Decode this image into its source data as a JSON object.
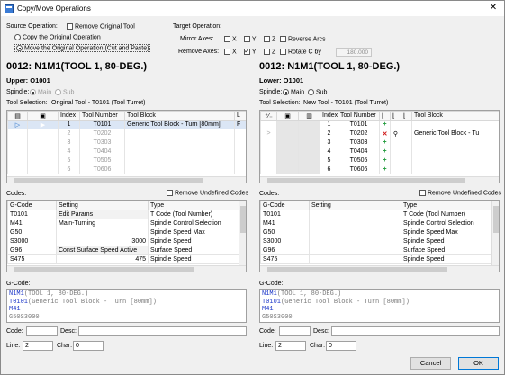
{
  "window": {
    "title": "Copy/Move Operations",
    "close_glyph": "✕"
  },
  "source_op": {
    "label": "Source Operation:",
    "remove_original": "Remove Original Tool",
    "copy_label": "Copy the Original Operation",
    "move_label": "Move the Original Operation (Cut and Paste)"
  },
  "target_op": {
    "label": "Target Operation:",
    "mirror_label": "Mirror Axes:",
    "remove_label": "Remove Axes:",
    "x": "X",
    "y": "Y",
    "z": "Z",
    "reverse_arcs": "Reverse Arcs",
    "rotate_c": "Rotate C by",
    "rotate_value": "180.000"
  },
  "left": {
    "title": "0012: N1M1(TOOL 1, 80-DEG.)",
    "subtitle": "Upper: O1001",
    "spindle_label": "Spindle:",
    "spindle_main": "Main",
    "spindle_sub": "Sub",
    "toolsel_label": "Tool Selection:",
    "toolsel_value": "Original Tool - T0101 (Tool Turret)",
    "cols": {
      "index": "Index",
      "tool_number": "Tool Number",
      "tool_block": "Tool Block",
      "extra": "L"
    },
    "rows": [
      {
        "index": "1",
        "tool": "T0101",
        "block": "Generic Tool Block - Turn [80mm]",
        "extra": "F"
      },
      {
        "index": "2",
        "tool": "T0202",
        "block": "",
        "extra": ""
      },
      {
        "index": "3",
        "tool": "T0303",
        "block": "",
        "extra": ""
      },
      {
        "index": "4",
        "tool": "T0404",
        "block": "",
        "extra": ""
      },
      {
        "index": "5",
        "tool": "T0505",
        "block": "",
        "extra": ""
      },
      {
        "index": "6",
        "tool": "T0606",
        "block": "",
        "extra": ""
      }
    ],
    "codes_label": "Codes:",
    "remove_undefined": "Remove Undefined Codes",
    "code_cols": {
      "gcode": "G-Code",
      "setting": "Setting",
      "type": "Type"
    },
    "codes": [
      {
        "gcode": "T0101",
        "setting": "Edit Params",
        "value": "",
        "type": "T Code (Tool Number)"
      },
      {
        "gcode": "M41",
        "setting": "Main-Turning",
        "value": "",
        "type": "Spindle Control Selection"
      },
      {
        "gcode": "G50",
        "setting": "",
        "value": "",
        "type": "Spindle Speed Max"
      },
      {
        "gcode": "S3000",
        "setting": "",
        "value": "3000",
        "type": "Spindle Speed"
      },
      {
        "gcode": "G96",
        "setting": "Const Surface Speed Active",
        "value": "",
        "type": "Surface Speed"
      },
      {
        "gcode": "S475",
        "setting": "",
        "value": "475",
        "type": "Spindle Speed"
      }
    ],
    "gcode_label": "G-Code:",
    "gcode_lines": [
      "N1M1(TOOL 1, 80-DEG.)",
      "T0101(Generic Tool Block - Turn [80mm])",
      "M41",
      "G50S3000"
    ],
    "code_label": "Code:",
    "desc_label": "Desc:",
    "line_label": "Line:",
    "line_value": "2",
    "char_label": "Char:",
    "char_value": "0"
  },
  "right": {
    "title": "0012: N1M1(TOOL 1, 80-DEG.)",
    "subtitle": "Lower: O1001",
    "spindle_label": "Spindle:",
    "spindle_main": "Main",
    "spindle_sub": "Sub",
    "toolsel_label": "Tool Selection:",
    "toolsel_value": "New Tool - T0101 (Tool Turret)",
    "cols": {
      "index": "Index",
      "tool_number": "Tool Number",
      "tool_block": "Tool Block"
    },
    "rows": [
      {
        "index": "1",
        "tool": "T0101",
        "block": "",
        "action": "+"
      },
      {
        "index": "2",
        "tool": "T0202",
        "block": "Generic Tool Block - Tu",
        "action": "x"
      },
      {
        "index": "3",
        "tool": "T0303",
        "block": "",
        "action": "+"
      },
      {
        "index": "4",
        "tool": "T0404",
        "block": "",
        "action": "+"
      },
      {
        "index": "5",
        "tool": "T0505",
        "block": "",
        "action": "+"
      },
      {
        "index": "6",
        "tool": "T0606",
        "block": "",
        "action": "+"
      }
    ],
    "codes_label": "Codes:",
    "remove_undefined": "Remove Undefined Codes",
    "code_cols": {
      "gcode": "G-Code",
      "setting": "Setting",
      "type": "Type"
    },
    "codes": [
      {
        "gcode": "T0101",
        "setting": "",
        "value": "",
        "type": "T Code (Tool Number)"
      },
      {
        "gcode": "M41",
        "setting": "",
        "value": "",
        "type": "Spindle Control Selection"
      },
      {
        "gcode": "G50",
        "setting": "",
        "value": "",
        "type": "Spindle Speed Max"
      },
      {
        "gcode": "S3000",
        "setting": "",
        "value": "",
        "type": "Spindle Speed"
      },
      {
        "gcode": "G96",
        "setting": "",
        "value": "",
        "type": "Surface Speed"
      },
      {
        "gcode": "S475",
        "setting": "",
        "value": "",
        "type": "Spindle Speed"
      }
    ],
    "gcode_label": "G-Code:",
    "gcode_lines": [
      "N1M1(TOOL 1, 80-DEG.)",
      "T0101(Generic Tool Block - Turn [80mm])",
      "M41",
      "G50S3000"
    ],
    "code_label": "Code:",
    "desc_label": "Desc:",
    "line_label": "Line:",
    "line_value": "2",
    "char_label": "Char:",
    "char_value": "0"
  },
  "buttons": {
    "cancel": "Cancel",
    "ok": "OK"
  },
  "colors": {
    "gcode_keyword": "#1a35c8",
    "comment": "#7a7a7a",
    "add_green": "#1f9a3a",
    "remove_red": "#d01818",
    "selection": "#2a72c8"
  }
}
